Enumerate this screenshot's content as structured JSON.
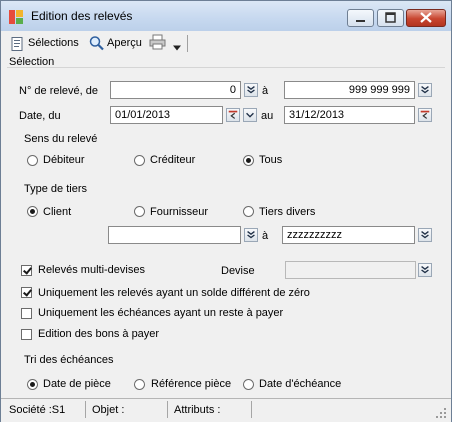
{
  "window": {
    "title": "Edition des relevés"
  },
  "toolbar": {
    "selections_label": "Sélections",
    "apercu_label": "Aperçu"
  },
  "group": {
    "label": "Sélection"
  },
  "releve": {
    "label": "N° de relevé, de",
    "from": "0",
    "a_label": "à",
    "to": "999 999 999"
  },
  "date": {
    "label": "Date, du",
    "from": "01/01/2013",
    "au_label": "au",
    "to": "31/12/2013"
  },
  "sens": {
    "label": "Sens du relevé",
    "options": [
      "Débiteur",
      "Créditeur",
      "Tous"
    ],
    "selected": "Tous"
  },
  "tiers": {
    "label": "Type de tiers",
    "options": [
      "Client",
      "Fournisseur",
      "Tiers divers"
    ],
    "selected": "Client",
    "from": "",
    "a_label": "à",
    "to": "zzzzzzzzzz"
  },
  "options": {
    "multidevises_label": "Relevés multi-devises",
    "multidevises_checked": true,
    "devise_label": "Devise",
    "devise_value": "",
    "solde_label": "Uniquement les relevés ayant un solde différent de zéro",
    "solde_checked": true,
    "echeances_label": "Uniquement les échéances ayant un reste à payer",
    "echeances_checked": false,
    "bons_label": "Edition des bons à payer",
    "bons_checked": false
  },
  "tri": {
    "label": "Tri des échéances",
    "options": [
      "Date de pièce",
      "Référence pièce",
      "Date d'échéance"
    ],
    "selected": "Date de pièce"
  },
  "status": {
    "societe": "Société :S1",
    "objet": "Objet :",
    "attributs": "Attributs :"
  }
}
